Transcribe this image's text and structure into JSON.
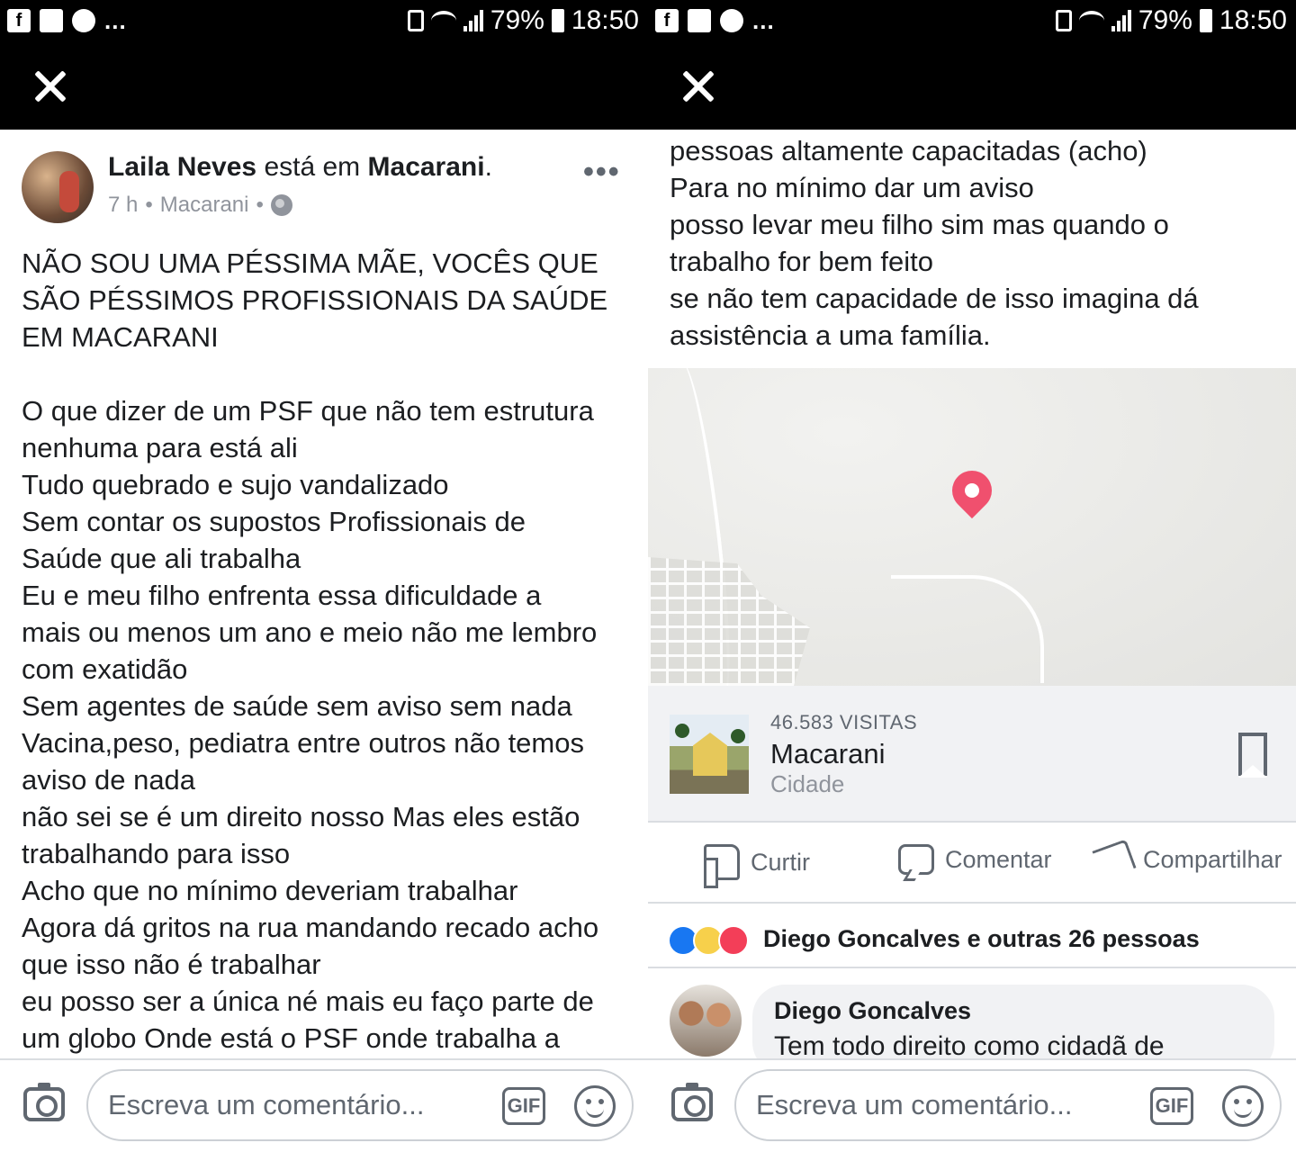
{
  "status_bar": {
    "battery": "79%",
    "time": "18:50",
    "left_icons": [
      "facebook-icon",
      "gallery-icon",
      "phone-icon"
    ],
    "more": "..."
  },
  "post": {
    "author": "Laila Neves",
    "connector": "está em",
    "location": "Macarani",
    "time": "7 h",
    "meta_location": "Macarani",
    "audience_icon": "globe-icon",
    "text_part1": "NÃO SOU UMA PÉSSIMA MÃE, VOCÊS QUE\nSÃO PÉSSIMOS PROFISSIONAIS DA SAÚDE\nEM MACARANI\n\nO que dizer de um PSF que não tem estrutura\nnenhuma para está ali\nTudo quebrado e sujo vandalizado\nSem contar os supostos Profissionais de\nSaúde que ali trabalha\nEu e meu filho enfrenta essa dificuldade a\nmais ou menos um ano e meio não me lembro\ncom exatidão\nSem agentes de saúde sem aviso sem nada\nVacina,peso, pediatra entre outros não temos\naviso de nada\nnão sei se é um direito nosso Mas eles estão\ntrabalhando para isso\nAcho que no mínimo deveriam trabalhar\nAgora dá gritos na rua mandando recado acho\nque isso não é trabalhar\neu posso ser a única né mais eu faço parte de\num globo Onde está o PSF onde trabalha a",
    "text_part2": "pessoas altamente capacitadas (acho)\nPara no mínimo dar um aviso\nposso levar meu filho sim mas quando o\ntrabalho for bem feito\nse não tem capacidade de isso imagina dá\nassistência a uma família."
  },
  "place": {
    "visits": "46.583 VISITAS",
    "name": "Macarani",
    "type": "Cidade"
  },
  "actions": {
    "like": "Curtir",
    "comment": "Comentar",
    "share": "Compartilhar"
  },
  "reactions": {
    "text": "Diego Goncalves e outras 26 pessoas",
    "icons": [
      "like-reaction-icon",
      "sad-reaction-icon",
      "love-reaction-icon"
    ]
  },
  "comment": {
    "author": "Diego Goncalves",
    "text": "Tem todo direito como cidadã de"
  },
  "composer": {
    "placeholder": "Escreva um comentário...",
    "gif": "GIF"
  },
  "colors": {
    "header_bg": "#000000",
    "map_pin": "#f0506e",
    "like_blue": "#1877f2",
    "card_bg": "#f1f2f4"
  }
}
